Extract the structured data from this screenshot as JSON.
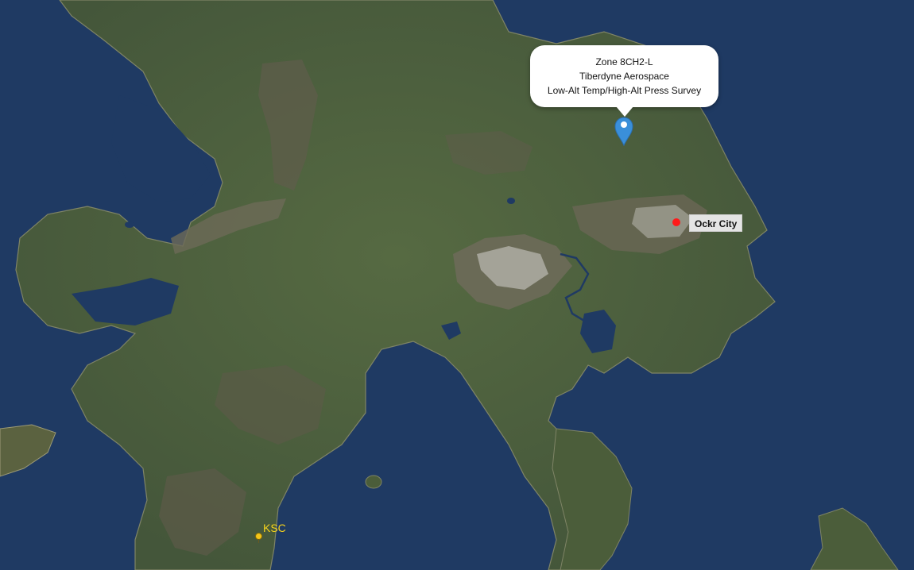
{
  "map": {
    "colors": {
      "ocean": "#1f3a63",
      "land": "#4b5d3a",
      "highland": "#5d5845",
      "snow": "#a8a8a0"
    }
  },
  "popup": {
    "zone": "Zone 8CH2-L",
    "company": "Tiberdyne Aerospace",
    "mission": "Low-Alt Temp/High-Alt Press Survey"
  },
  "marker": {
    "icon": "map-pin-icon",
    "color": "#3a8fd9"
  },
  "cities": [
    {
      "name": "Ockr City",
      "color": "#ff1a1a"
    }
  ],
  "sites": [
    {
      "name": "KSC",
      "color": "#f5d21c"
    }
  ]
}
